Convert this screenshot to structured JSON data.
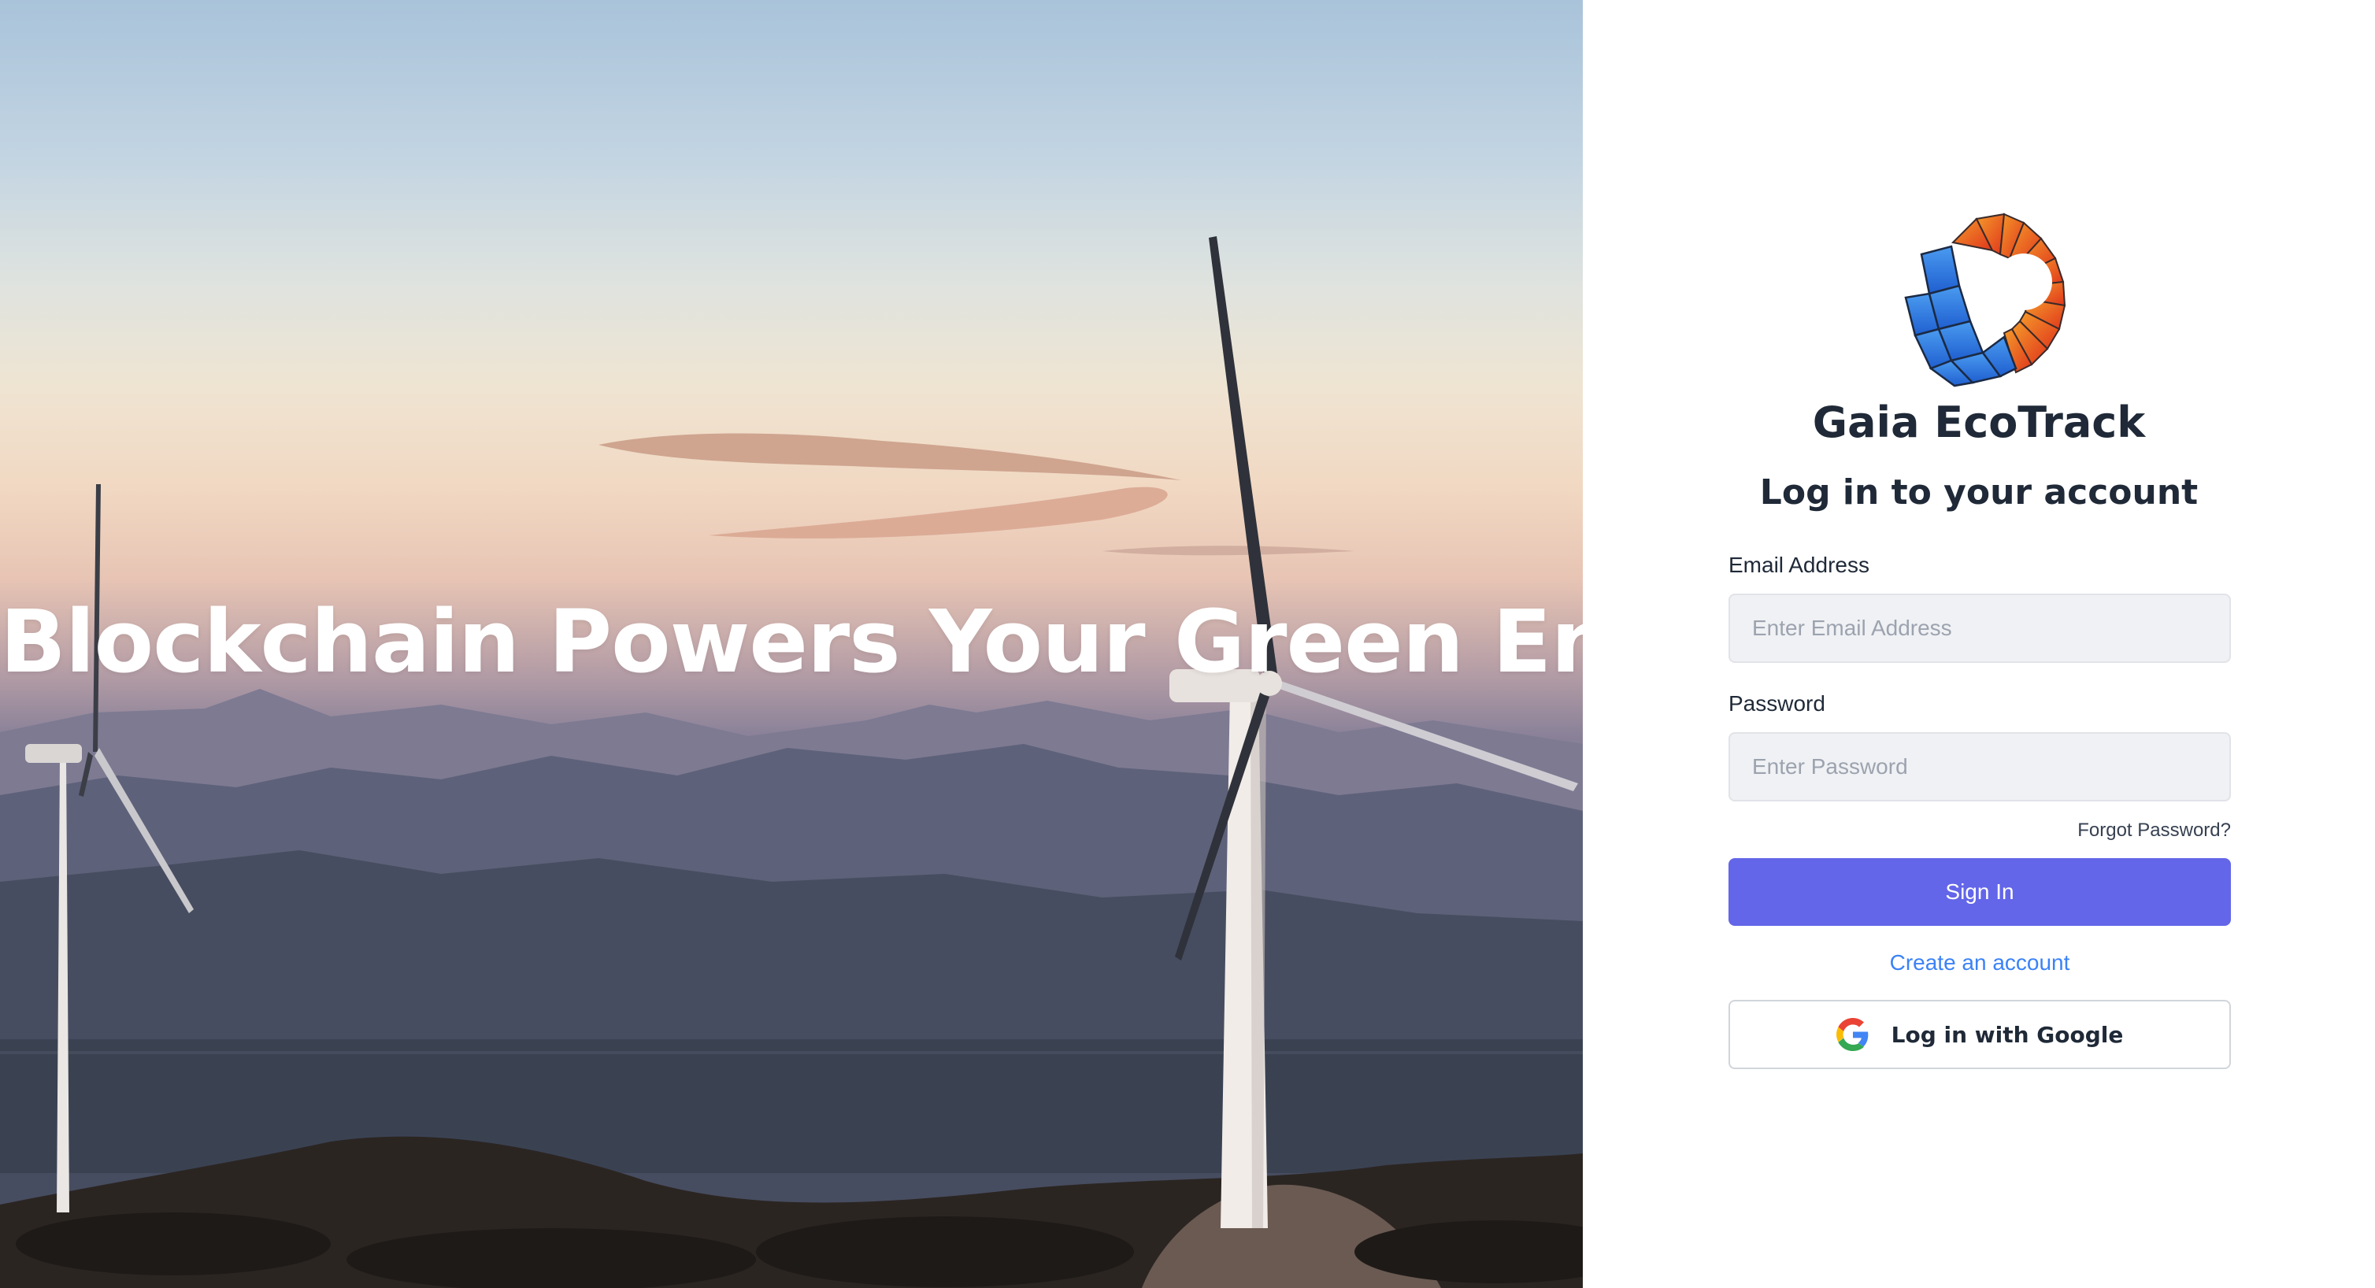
{
  "hero": {
    "headline": "Blockchain Powers Your Green Energy"
  },
  "brand": {
    "name": "Gaia EcoTrack",
    "logo_icon": "sun-solar-logo-icon",
    "colors": {
      "orange": "#f26b21",
      "red": "#e23b1e",
      "blue": "#2f7de8"
    }
  },
  "login": {
    "title": "Log in to your account",
    "email": {
      "label": "Email Address",
      "placeholder": "Enter Email Address",
      "value": ""
    },
    "password": {
      "label": "Password",
      "placeholder": "Enter Password",
      "value": ""
    },
    "forgot_label": "Forgot Password?",
    "signin_label": "Sign In",
    "create_label": "Create an account",
    "google_label": "Log in with Google",
    "google_icon": "google-g-icon"
  },
  "colors": {
    "accent": "#6366e8",
    "link": "#3b82f6"
  }
}
